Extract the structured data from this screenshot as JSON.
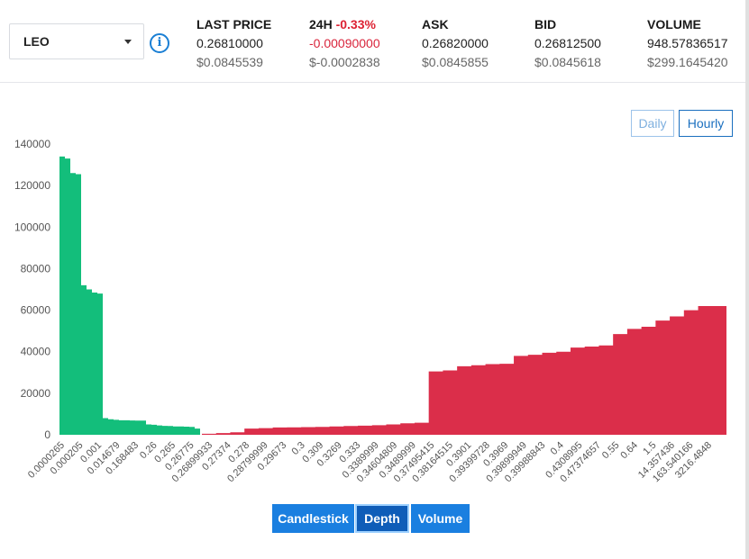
{
  "coin": {
    "selected": "LEO",
    "icon": "chevron-down-icon"
  },
  "info": {
    "icon": "info-icon",
    "glyph": "i"
  },
  "stats": {
    "last_price": {
      "label": "LAST PRICE",
      "value": "0.26810000",
      "usd": "$0.0845539"
    },
    "change": {
      "label": "24H",
      "pct": "-0.33%",
      "value": "-0.00090000",
      "usd": "$-0.0002838"
    },
    "ask": {
      "label": "ASK",
      "value": "0.26820000",
      "usd": "$0.0845855"
    },
    "bid": {
      "label": "BID",
      "value": "0.26812500",
      "usd": "$0.0845618"
    },
    "volume": {
      "label": "VOLUME",
      "value": "948.57836517",
      "usd": "$299.1645420"
    }
  },
  "range": {
    "daily": "Daily",
    "hourly": "Hourly"
  },
  "views": {
    "candlestick": "Candlestick",
    "depth": "Depth",
    "volume": "Volume",
    "active": "Depth"
  },
  "colors": {
    "bid": "#13be7b",
    "ask": "#db2e4a",
    "accent": "#1a7fe0"
  },
  "chart_data": {
    "type": "area",
    "ylim": [
      0,
      140000
    ],
    "y_ticks": [
      "0",
      "20000",
      "40000",
      "60000",
      "80000",
      "100000",
      "120000",
      "140000"
    ],
    "x_ticks": [
      "0.0000265",
      "0.000205",
      "0.001",
      "0.014679",
      "0.168483",
      "0.26",
      "0.265",
      "0.26775",
      "0.26899933",
      "0.27374",
      "0.278",
      "0.28799999",
      "0.29673",
      "0.3",
      "0.309",
      "0.3269",
      "0.333",
      "0.3389999",
      "0.34604809",
      "0.3489999",
      "0.37495415",
      "0.38164515",
      "0.3901",
      "0.39399728",
      "0.3969",
      "0.39899949",
      "0.39988843",
      "0.4",
      "0.4308995",
      "0.47374657",
      "0.55",
      "0.64",
      "1.5",
      "14.357436",
      "163.540166",
      "3216.4848"
    ],
    "series": [
      {
        "side": "bid",
        "values": [
          134000,
          133000,
          126000,
          125500,
          72000,
          70000,
          68500,
          68000,
          8000,
          7500,
          7200,
          7000,
          7000,
          6900,
          6800,
          6800,
          5000,
          4800,
          4500,
          4300,
          4200,
          4000,
          4000,
          3900,
          3800,
          3000,
          0
        ]
      },
      {
        "side": "ask",
        "values": [
          500,
          800,
          1200,
          3000,
          3200,
          3500,
          3600,
          3700,
          3800,
          4000,
          4200,
          4400,
          4600,
          5000,
          5500,
          5800,
          30500,
          31000,
          33000,
          33500,
          34000,
          34200,
          38000,
          38500,
          39500,
          40000,
          42000,
          42500,
          43000,
          48500,
          51000,
          52000,
          55000,
          57000,
          60000,
          62000,
          62000,
          62000
        ]
      }
    ]
  }
}
